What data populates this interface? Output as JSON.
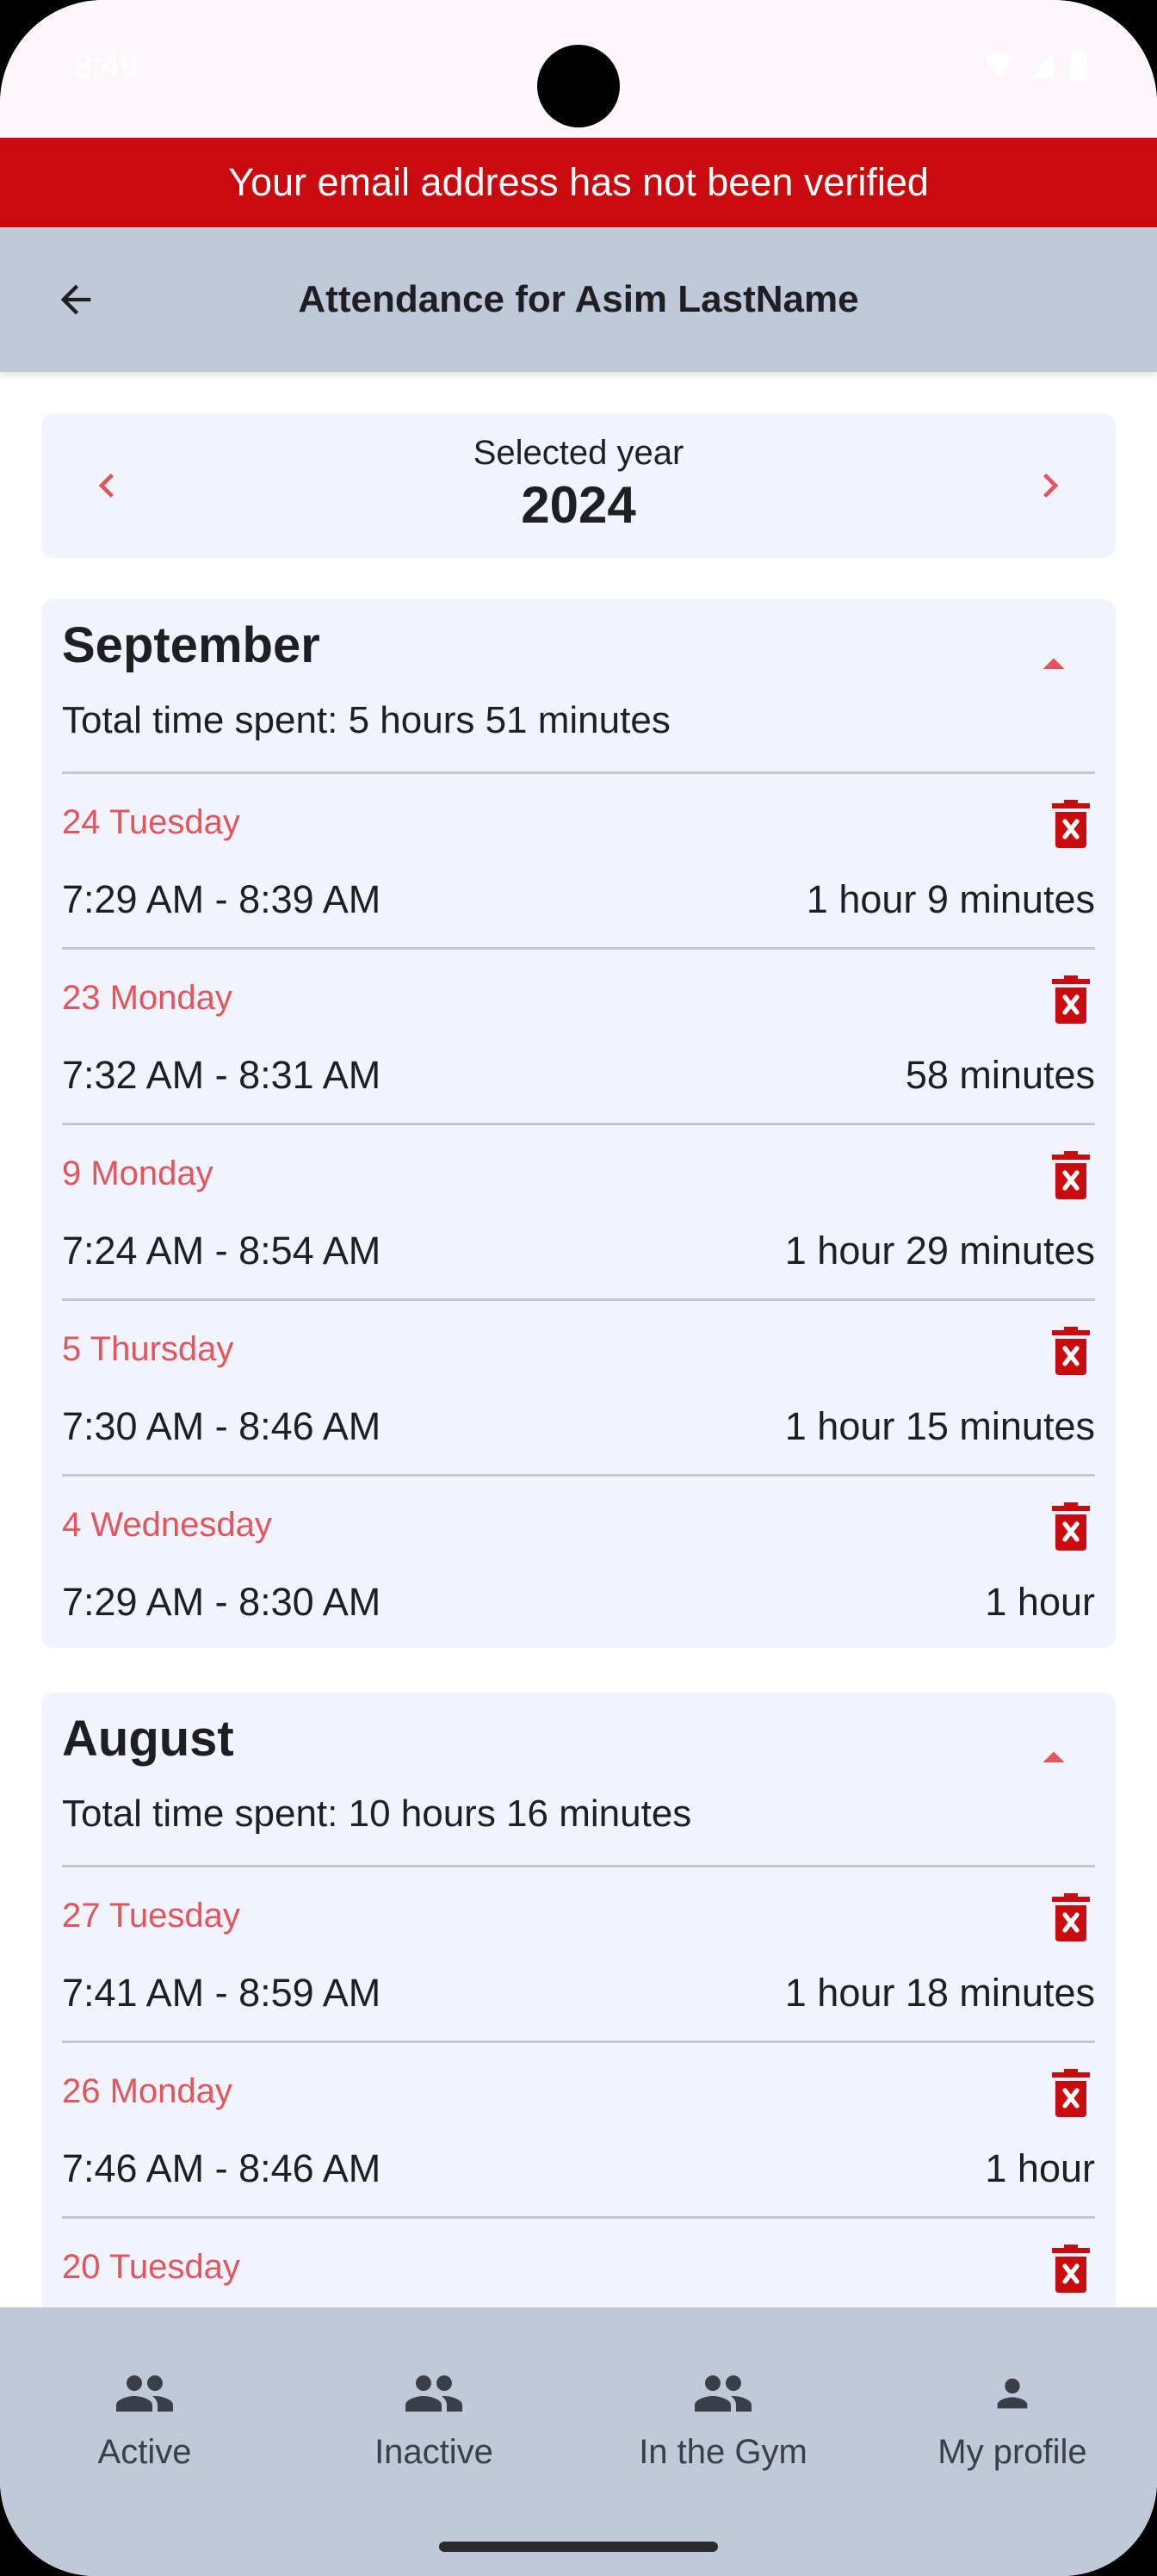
{
  "status_bar": {
    "time": "8:49"
  },
  "banner": {
    "text": "Your email address has not been verified"
  },
  "app_bar": {
    "title": "Attendance for Asim LastName"
  },
  "year_selector": {
    "label": "Selected year",
    "year": "2024"
  },
  "months": [
    {
      "name": "September",
      "total": "Total time spent: 5 hours 51 minutes",
      "entries": [
        {
          "day": "24 Tuesday",
          "time": "7:29 AM - 8:39 AM",
          "duration": "1 hour 9 minutes"
        },
        {
          "day": "23 Monday",
          "time": "7:32 AM - 8:31 AM",
          "duration": "58 minutes"
        },
        {
          "day": "9 Monday",
          "time": "7:24 AM - 8:54 AM",
          "duration": "1 hour 29 minutes"
        },
        {
          "day": "5 Thursday",
          "time": "7:30 AM - 8:46 AM",
          "duration": "1 hour 15 minutes"
        },
        {
          "day": "4 Wednesday",
          "time": "7:29 AM - 8:30 AM",
          "duration": "1 hour"
        }
      ]
    },
    {
      "name": "August",
      "total": "Total time spent: 10 hours 16 minutes",
      "entries": [
        {
          "day": "27 Tuesday",
          "time": "7:41 AM - 8:59 AM",
          "duration": "1 hour 18 minutes"
        },
        {
          "day": "26 Monday",
          "time": "7:46 AM - 8:46 AM",
          "duration": "1 hour"
        },
        {
          "day": "20 Tuesday",
          "time": "",
          "duration": ""
        }
      ]
    }
  ],
  "bottom_nav": [
    {
      "label": "Active",
      "icon": "group-icon"
    },
    {
      "label": "Inactive",
      "icon": "group-icon"
    },
    {
      "label": "In the Gym",
      "icon": "group-icon"
    },
    {
      "label": "My profile",
      "icon": "person-icon"
    }
  ],
  "colors": {
    "accent": "#e3545c",
    "banner": "#c90b0f",
    "delete": "#c90b0f",
    "app_bar": "#c0c9da",
    "card": "#f1f4fc"
  }
}
